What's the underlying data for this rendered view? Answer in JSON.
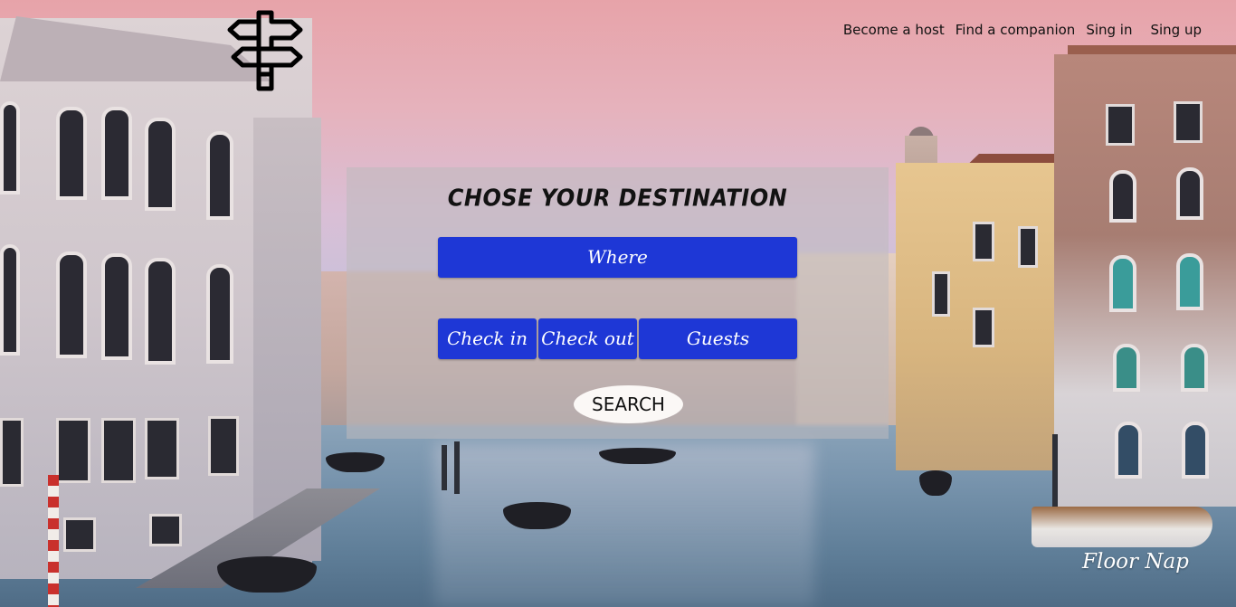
{
  "nav": {
    "items": [
      {
        "label": "Become a host"
      },
      {
        "label": "Find a companion"
      },
      {
        "label": "Sing in"
      },
      {
        "label": "Sing up"
      }
    ]
  },
  "logo": {
    "icon": "signpost-icon"
  },
  "search_panel": {
    "title": "CHOSE YOUR DESTINATION",
    "where_label": "Where",
    "check_in_label": "Check in",
    "check_out_label": "Check out",
    "guests_label": "Guests",
    "search_label": "SEARCH"
  },
  "footer": {
    "brand": "Floor Nap"
  },
  "colors": {
    "field_blue": "#1e37d6",
    "search_button_bg": "#fbf8f6",
    "panel_overlay": "rgba(190,185,190,0.55)"
  }
}
